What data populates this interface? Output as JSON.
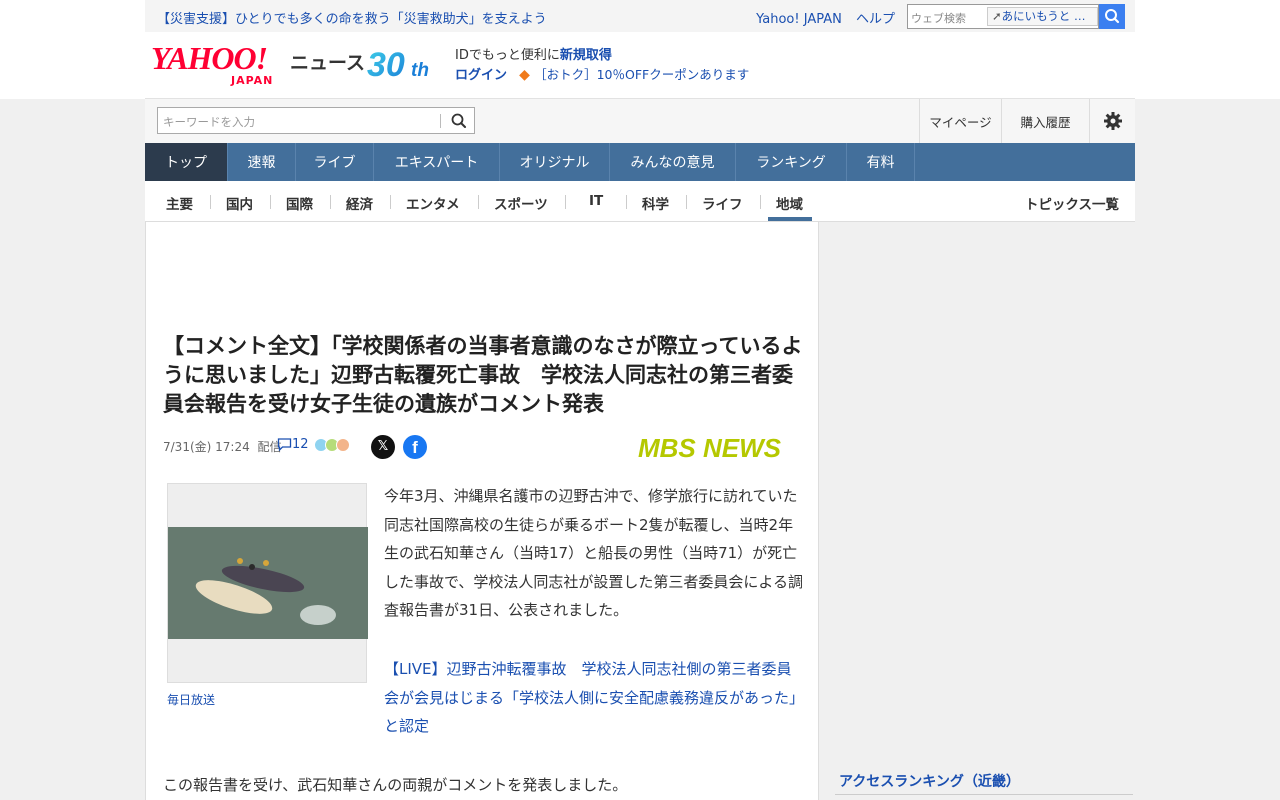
{
  "topbar": {
    "promo": "【災害支援】ひとりでも多くの命を救う「災害救助犬」を支えよう",
    "links": [
      "Yahoo! JAPAN",
      "ヘルプ"
    ],
    "web_search_placeholder": "ウェブ検索",
    "web_search_chip": "あにいもうと …"
  },
  "header": {
    "logo_text": "YAHOO!",
    "logo_sub": "JAPAN",
    "news_label": "ニュース",
    "badge": "30th",
    "id_text": "IDでもっと便利に",
    "signup": "新規取得",
    "login": "ログイン",
    "coupon": "［おトク］10％OFFクーポンあります"
  },
  "search": {
    "placeholder": "キーワードを入力",
    "links": [
      "マイページ",
      "購入履歴"
    ]
  },
  "main_nav": [
    {
      "label": "トップ",
      "active": true
    },
    {
      "label": "速報"
    },
    {
      "label": "ライブ"
    },
    {
      "label": "エキスパート"
    },
    {
      "label": "オリジナル"
    },
    {
      "label": "みんなの意見"
    },
    {
      "label": "ランキング"
    },
    {
      "label": "有料"
    }
  ],
  "sub_nav": [
    "主要",
    "国内",
    "国際",
    "経済",
    "エンタメ",
    "スポーツ",
    "IT",
    "科学",
    "ライフ",
    "地域"
  ],
  "sub_nav_active": "地域",
  "topics_link": "トピックス一覧",
  "article": {
    "title": "【コメント全文】「学校関係者の当事者意識のなさが際立っているように思いました」辺野古転覆死亡事故　学校法人同志社の第三者委員会報告を受け女子生徒の遺族がコメント発表",
    "date": "7/31(金) 17:24",
    "date_suffix": "配信",
    "comment_count": "12",
    "source": "MBS NEWS",
    "caption": "毎日放送",
    "body": "今年3月、沖縄県名護市の辺野古沖で、修学旅行に訪れていた同志社国際高校の生徒らが乗るボート2隻が転覆し、当時2年生の武石知華さん（当時17）と船長の男性（当時71）が死亡した事故で、学校法人同志社が設置した第三者委員会による調査報告書が31日、公表されました。",
    "live_link": "【LIVE】辺野古沖転覆事故　学校法人同志社側の第三者委員会が会見はじまる「学校法人側に安全配慮義務違反があった」と認定",
    "body2": "この報告書を受け、武石知華さんの両親がコメントを発表しました。"
  },
  "rail": {
    "ranking_title": "アクセスランキング（近畿）"
  },
  "colors": {
    "nav": "#436f9b",
    "nav_active": "#2c3b4d",
    "link": "#1a4fb0",
    "brand_red": "#ff0033",
    "mbs_green": "#b5c800"
  }
}
